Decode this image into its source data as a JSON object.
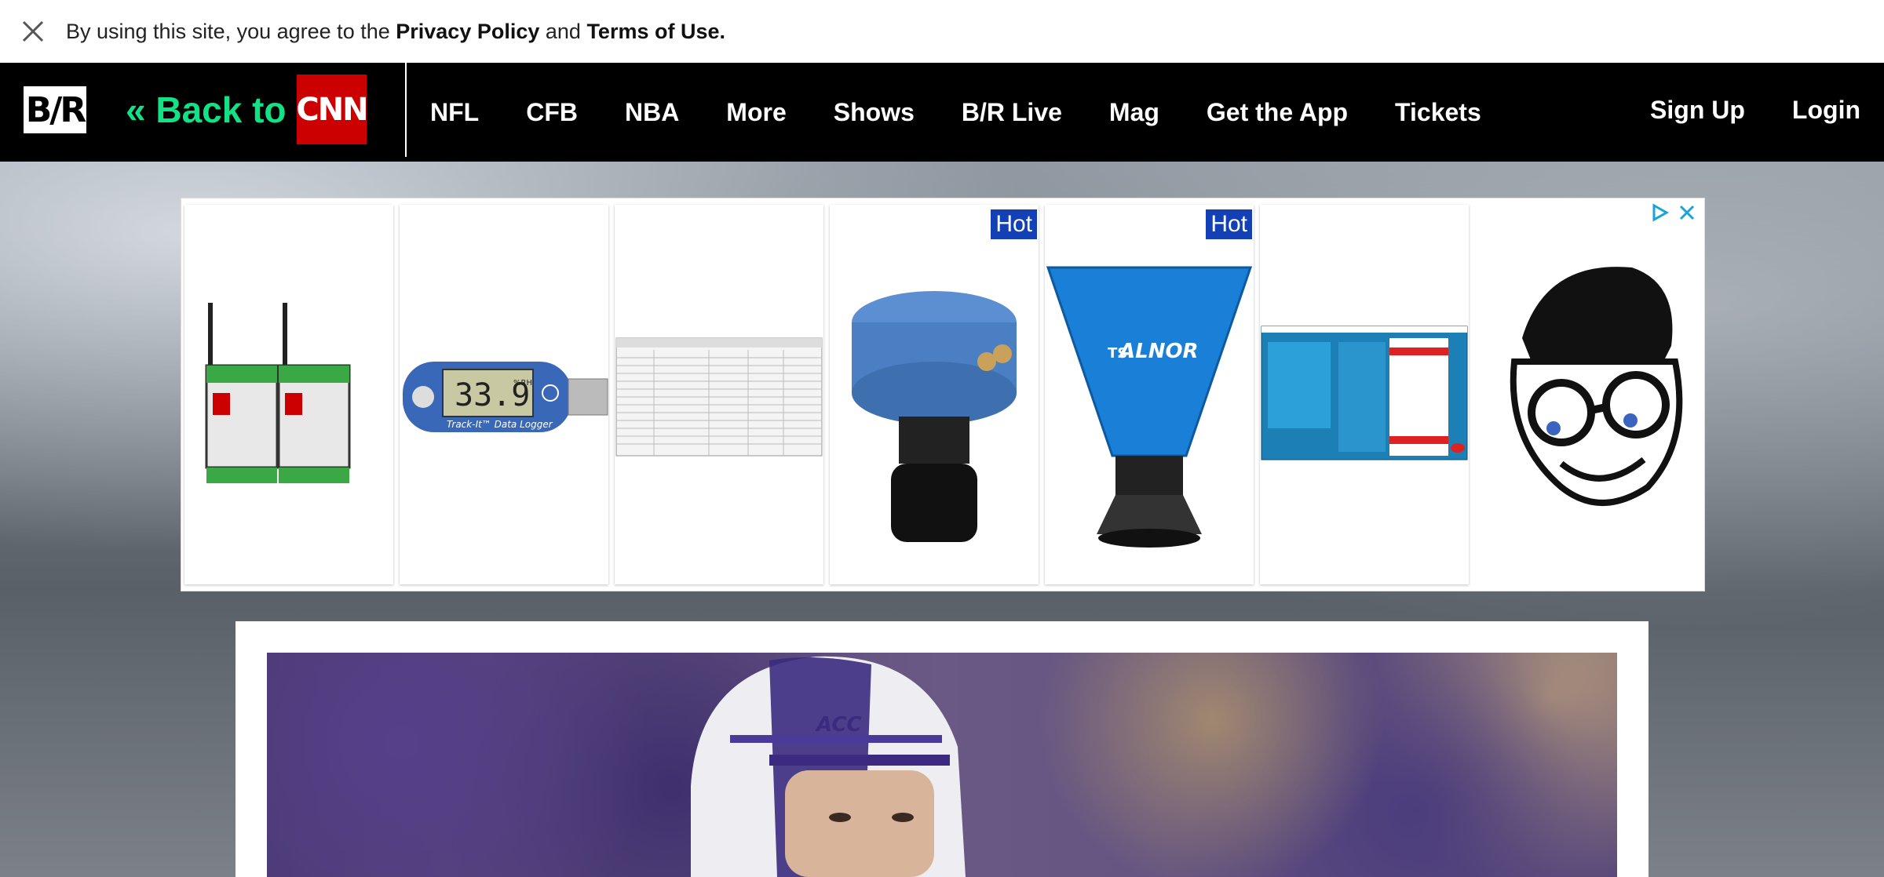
{
  "cookie_banner": {
    "prefix": "By using this site, you agree to the ",
    "privacy": "Privacy Policy",
    "and": " and ",
    "terms": "Terms of Use."
  },
  "header": {
    "back_to": "« Back to",
    "cnn": "CNN",
    "br": "B/R",
    "nav": [
      "NFL",
      "CFB",
      "NBA",
      "More",
      "Shows",
      "B/R Live",
      "Mag",
      "Get the App",
      "Tickets"
    ],
    "sign_up": "Sign Up",
    "login": "Login"
  },
  "ad": {
    "badges": [
      "Hot",
      "Hot"
    ],
    "lcd_reading": "33.9",
    "lcd_unit": "%RH",
    "logger_label": "Track-It™ Data Logger",
    "brand": "ALNOR",
    "brand_prefix": "TSI",
    "acc_helmet": "ACC"
  },
  "colors": {
    "accent_green": "#12e286",
    "cnn_red": "#cc0000",
    "hot_blue": "#1440b5"
  }
}
